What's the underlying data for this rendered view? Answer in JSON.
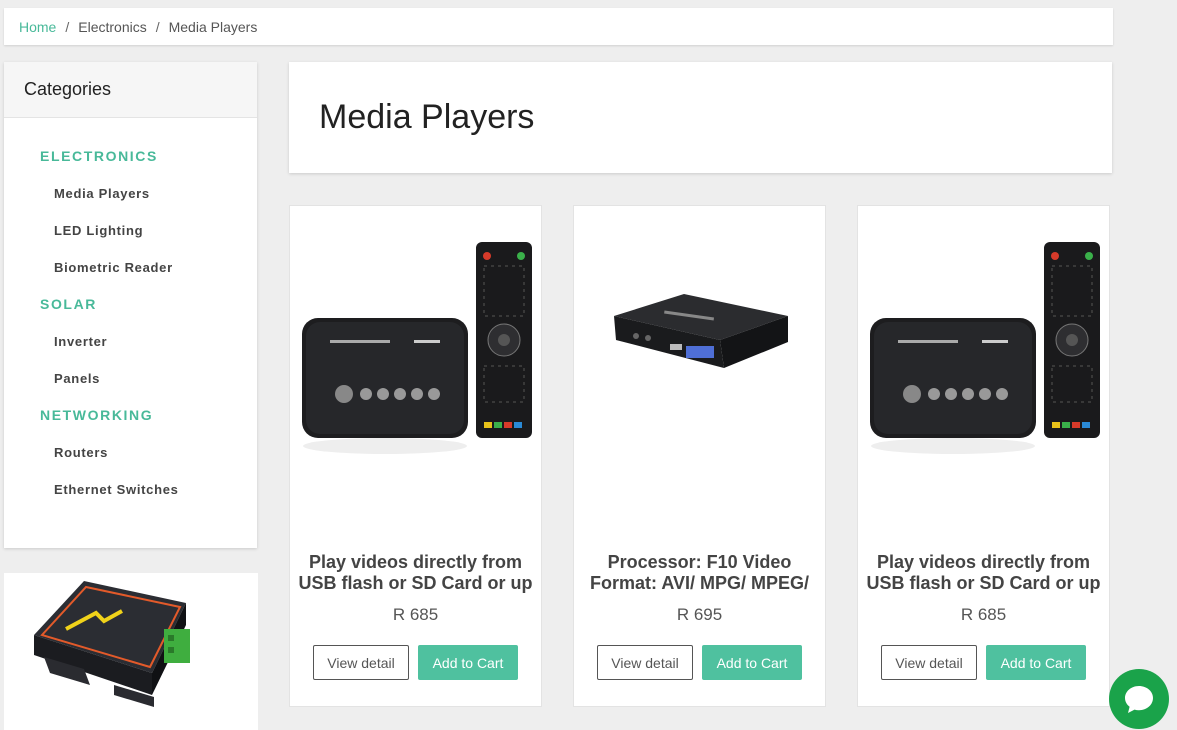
{
  "breadcrumb": {
    "home": "Home",
    "sep": "/",
    "level1": "Electronics",
    "current": "Media Players"
  },
  "sidebar": {
    "title": "Categories",
    "groups": [
      {
        "label": "ELECTRONICS",
        "items": [
          "Media Players",
          "LED Lighting",
          "Biometric Reader"
        ]
      },
      {
        "label": "SOLAR",
        "items": [
          "Inverter",
          "Panels"
        ]
      },
      {
        "label": "NETWORKING",
        "items": [
          "Routers",
          "Ethernet Switches"
        ]
      }
    ]
  },
  "page_title": "Media Players",
  "products": [
    {
      "name": "Play videos directly from USB flash or SD Card or up",
      "price": "R 685",
      "image": "media-player-with-remote",
      "view_label": "View detail",
      "cart_label": "Add to Cart"
    },
    {
      "name": "Processor: F10 Video Format: AVI/ MPG/ MPEG/",
      "price": "R 695",
      "image": "hd-media-player-box",
      "view_label": "View detail",
      "cart_label": "Add to Cart"
    },
    {
      "name": "Play videos directly from USB flash or SD Card or up",
      "price": "R 685",
      "image": "media-player-with-remote",
      "view_label": "View detail",
      "cart_label": "Add to Cart"
    }
  ],
  "promo_image": "ethernet-switch-device",
  "chat_icon": "chat-bubble-icon",
  "colors": {
    "accent": "#48b999",
    "button": "#4fc19f",
    "chat": "#1aa34a",
    "background": "#eeeeee"
  }
}
